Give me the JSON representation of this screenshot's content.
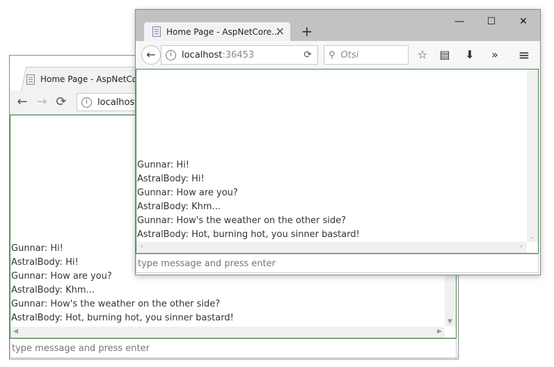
{
  "windows": {
    "back": {
      "tab_title": "Home Page - AspNetCor",
      "url_host": "localhost:",
      "messages": [
        "Gunnar: Hi!",
        "AstralBody: Hi!",
        "Gunnar: How are you?",
        "AstralBody: Khm...",
        "Gunnar: How's the weather on the other side?",
        "AstralBody: Hot, burning hot, you sinner bastard!"
      ],
      "input_placeholder": "type message and press enter"
    },
    "front": {
      "tab_title": "Home Page - AspNetCore...",
      "url_host": "localhost",
      "url_port": ":36453",
      "search_placeholder": "Otsi",
      "messages": [
        "Gunnar: Hi!",
        "AstralBody: Hi!",
        "Gunnar: How are you?",
        "AstralBody: Khm...",
        "Gunnar: How's the weather on the other side?",
        "AstralBody: Hot, burning hot, you sinner bastard!"
      ],
      "input_placeholder": "type message and press enter"
    }
  },
  "icons": {
    "back": "←",
    "forward": "→",
    "reload": "⟳",
    "close": "×",
    "new_tab": "+",
    "minimize": "—",
    "maximize": "☐",
    "window_close": "✕",
    "bookmark_star": "☆",
    "reader": "▤",
    "download": "⬇",
    "overflow": "»",
    "menu": "≡",
    "search": "⚲",
    "info": "i"
  },
  "colors": {
    "content_border": "#3c8a46",
    "titlebar": "#c2c2c2"
  }
}
